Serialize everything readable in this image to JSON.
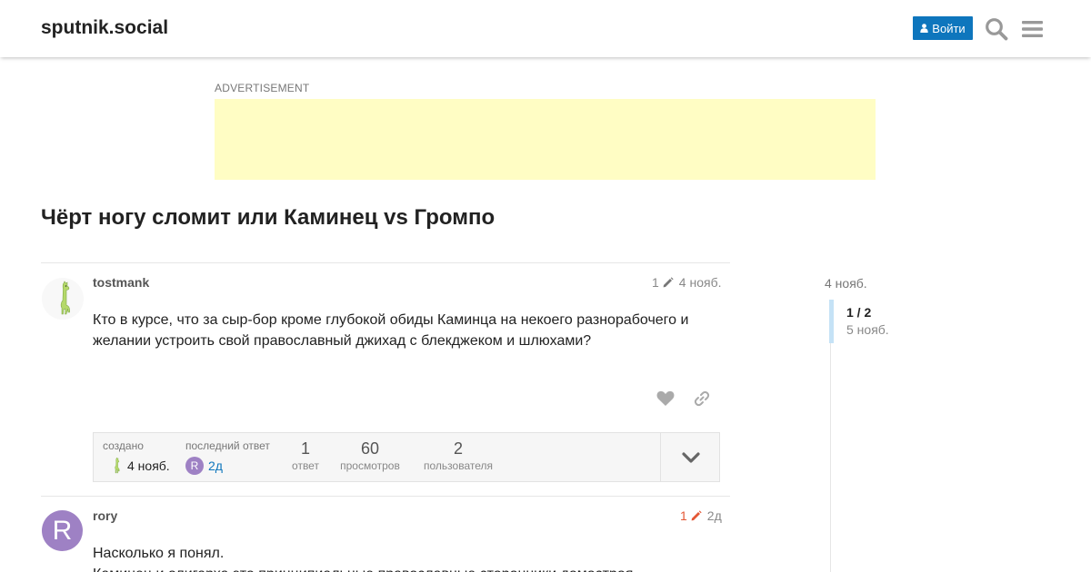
{
  "header": {
    "site_title": "sputnik.social",
    "login_label": "Войти"
  },
  "ad": {
    "label": "ADVERTISEMENT"
  },
  "topic": {
    "title": "Чёрт ногу сломит или Каминец vs Громпо"
  },
  "posts": [
    {
      "username": "tostmank",
      "edit_count": "1",
      "date": "4 нояб.",
      "body": "Кто в курсе, что за сыр-бор кроме глубокой обиды Каминца на некоего разнорабочего и желании устроить свой православный джихад с блекджеком и шлюхами?"
    },
    {
      "username": "rory",
      "avatar_letter": "R",
      "edit_count": "1",
      "date": "2д",
      "body_line1": "Насколько я понял.",
      "body_line2": "Каминец и олигарха это принципиальные православные сторонники домостроя"
    }
  ],
  "topic_map": {
    "created_label": "создано",
    "created_value": "4 нояб.",
    "last_reply_label": "последний ответ",
    "last_reply_avatar": "R",
    "last_reply_value": "2д",
    "replies_count": "1",
    "replies_label": "ответ",
    "views_count": "60",
    "views_label": "просмотров",
    "users_count": "2",
    "users_label": "пользователя"
  },
  "timeline": {
    "start_date": "4 нояб.",
    "position": "1 / 2",
    "current_date": "5 нояб."
  },
  "colors": {
    "accent": "#0e76bd",
    "edited_recent": "#e45735",
    "avatar_r": "#9e81c4",
    "ad_background": "#fffdc4"
  }
}
